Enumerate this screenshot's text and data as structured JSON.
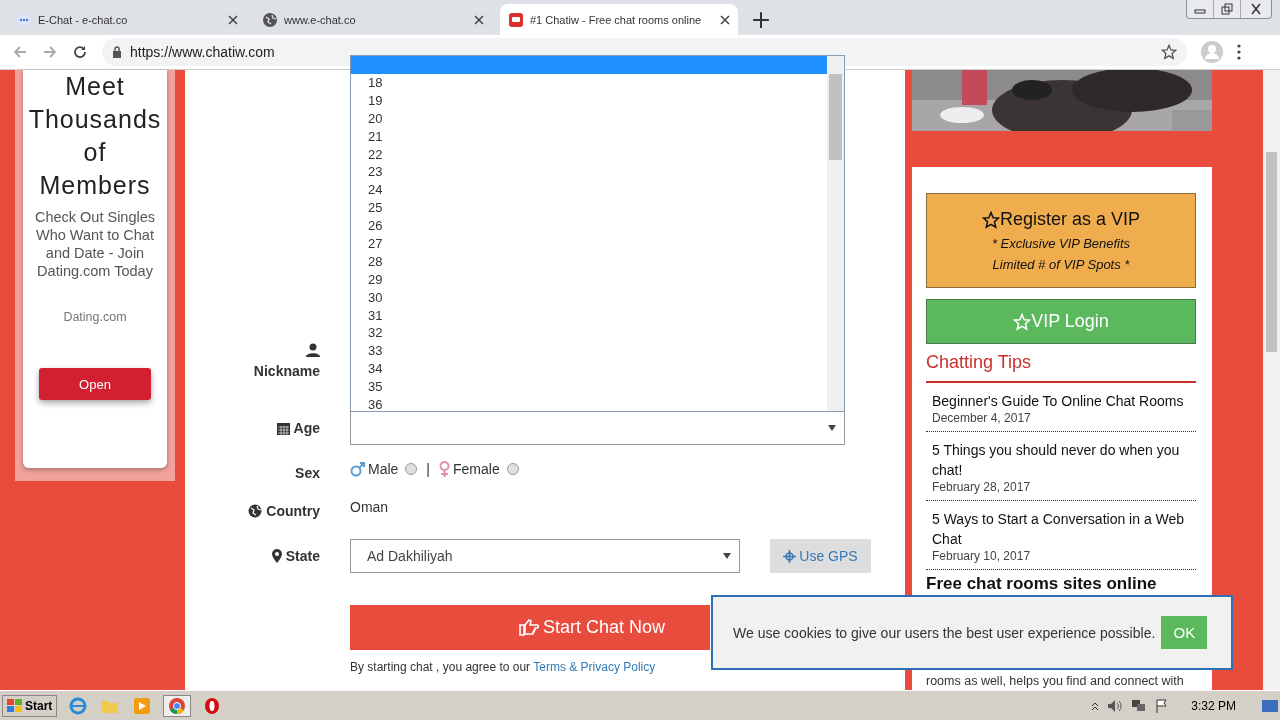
{
  "browser": {
    "tabs": [
      {
        "title": "E-Chat - e-chat.co",
        "selected": false
      },
      {
        "title": "www.e-chat.co",
        "selected": false
      },
      {
        "title": "#1 Chatiw - Free chat rooms online",
        "selected": true
      }
    ],
    "url": "https://www.chatiw.com"
  },
  "ad": {
    "title": "Meet Thousands of Members",
    "text": "Check Out Singles Who Want to Chat and Date - Join Dating.com Today",
    "source": "Dating.com",
    "button": "Open"
  },
  "form": {
    "nickname_label": "Nickname",
    "age_label": "Age",
    "age_list": {
      "blank_option_highlighted": true,
      "options": [
        {
          "label": "18",
          "selected": false
        },
        {
          "label": "19",
          "selected": false
        },
        {
          "label": "20",
          "selected": false
        },
        {
          "label": "21",
          "selected": false
        },
        {
          "label": "22",
          "selected": false
        },
        {
          "label": "23",
          "selected": false
        },
        {
          "label": "24",
          "selected": false
        },
        {
          "label": "25",
          "selected": false
        },
        {
          "label": "26",
          "selected": false
        },
        {
          "label": "27",
          "selected": false
        },
        {
          "label": "28",
          "selected": false
        },
        {
          "label": "29",
          "selected": false
        },
        {
          "label": "30",
          "selected": false
        },
        {
          "label": "31",
          "selected": false
        },
        {
          "label": "32",
          "selected": false
        },
        {
          "label": "33",
          "selected": false
        },
        {
          "label": "34",
          "selected": false
        },
        {
          "label": "35",
          "selected": false
        },
        {
          "label": "36",
          "selected": false
        }
      ]
    },
    "sex_label": "Sex",
    "sex_options": [
      {
        "label": "Male",
        "selected": false
      },
      {
        "label": "Female",
        "selected": false
      }
    ],
    "sex_separator": "|",
    "country_label": "Country",
    "country": "Oman",
    "state_label": "State",
    "state": "Ad Dakhiliyah",
    "gps_button": "Use GPS",
    "start_button": "Start Chat Now",
    "terms_text": "By starting chat , you agree to our",
    "terms_link": "Terms & Privacy Policy"
  },
  "sidebar": {
    "register": {
      "title": "Register as a VIP",
      "lines": [
        "* Exclusive VIP Benefits",
        "Limited # of VIP Spots *"
      ]
    },
    "login_button": "VIP Login",
    "tips_title": "Chatting Tips",
    "tips": [
      {
        "title": "Beginner's Guide To Online Chat Rooms",
        "date": "December 4, 2017"
      },
      {
        "title": "5 Things you should never do when you chat!",
        "date": "February 28, 2017"
      },
      {
        "title": "5 Ways to Start a Conversation in a Web Chat",
        "date": "February 10, 2017"
      }
    ],
    "section_title": "Free chat rooms sites online",
    "section_text": "rooms as well, helps you find and connect with"
  },
  "cookie_banner": {
    "text": "We use cookies to give our users the best user experience possible.",
    "button": "OK"
  },
  "taskbar": {
    "start": "Start",
    "clock": "3:32 PM"
  }
}
